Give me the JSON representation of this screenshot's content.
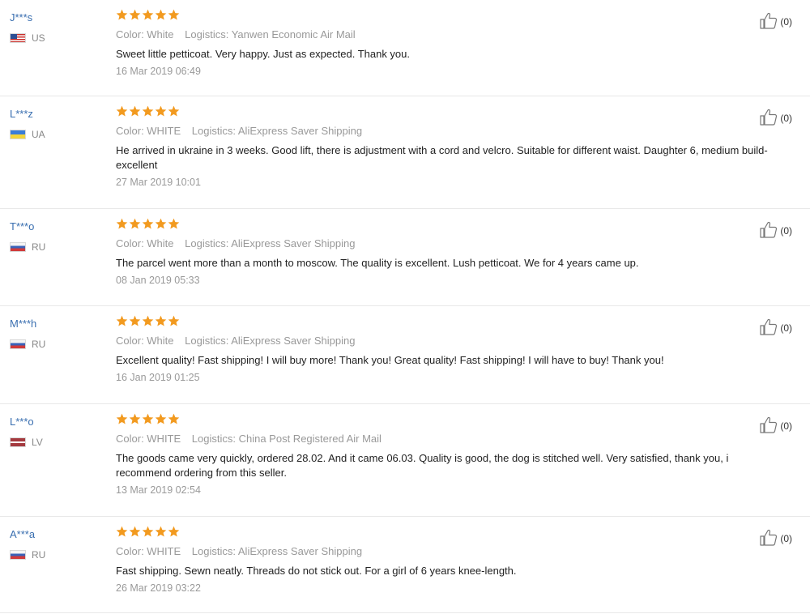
{
  "colors": {
    "star": "#f29a1f",
    "username": "#3a6fb0",
    "divider": "#e8e8e8"
  },
  "reviews": [
    {
      "user": "J***s",
      "country": "US",
      "flag": "us",
      "rating": 5,
      "color": "Color: White",
      "logistics": "Logistics: Yanwen Economic Air Mail",
      "text": "Sweet little petticoat. Very happy. Just as expected. Thank you.",
      "date": "16 Mar 2019 06:49",
      "helpful_count": "(0)",
      "helpful_icon": "thumbs-up-icon"
    },
    {
      "user": "L***z",
      "country": "UA",
      "flag": "ua",
      "rating": 5,
      "color": "Color: WHITE",
      "logistics": "Logistics: AliExpress Saver Shipping",
      "text": "He arrived in ukraine in 3 weeks. Good lift, there is adjustment with a cord and velcro. Suitable for different waist. Daughter 6, medium build-excellent",
      "date": "27 Mar 2019 10:01",
      "helpful_count": "(0)",
      "helpful_icon": "thumbs-up-icon"
    },
    {
      "user": "T***o",
      "country": "RU",
      "flag": "ru",
      "rating": 5,
      "color": "Color: White",
      "logistics": "Logistics: AliExpress Saver Shipping",
      "text": "The parcel went more than a month to moscow. The quality is excellent. Lush petticoat. We for 4 years came up.",
      "date": "08 Jan 2019 05:33",
      "helpful_count": "(0)",
      "helpful_icon": "thumbs-up-icon"
    },
    {
      "user": "M***h",
      "country": "RU",
      "flag": "ru",
      "rating": 5,
      "color": "Color: White",
      "logistics": "Logistics: AliExpress Saver Shipping",
      "text": "Excellent quality! Fast shipping! I will buy more! Thank you! Great quality! Fast shipping! I will have to buy! Thank you!",
      "date": "16 Jan 2019 01:25",
      "helpful_count": "(0)",
      "helpful_icon": "thumbs-up-icon"
    },
    {
      "user": "L***o",
      "country": "LV",
      "flag": "lv",
      "rating": 5,
      "color": "Color: WHITE",
      "logistics": "Logistics: China Post Registered Air Mail",
      "text": "The goods came very quickly, ordered 28.02. And it came 06.03. Quality is good, the dog is stitched well. Very satisfied, thank you, i recommend ordering from this seller.",
      "date": "13 Mar 2019 02:54",
      "helpful_count": "(0)",
      "helpful_icon": "thumbs-up-icon"
    },
    {
      "user": "A***a",
      "country": "RU",
      "flag": "ru",
      "rating": 5,
      "color": "Color: WHITE",
      "logistics": "Logistics: AliExpress Saver Shipping",
      "text": "Fast shipping. Sewn neatly. Threads do not stick out. For a girl of 6 years knee-length.",
      "date": "26 Mar 2019 03:22",
      "helpful_count": "(0)",
      "helpful_icon": "thumbs-up-icon"
    }
  ]
}
